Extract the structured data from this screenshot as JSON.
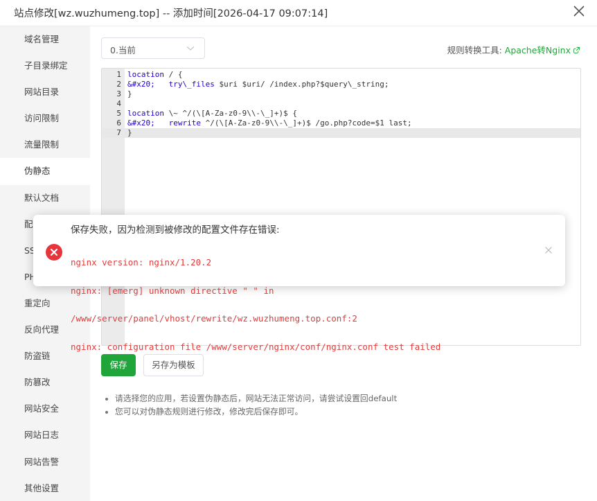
{
  "window": {
    "title": "站点修改[wz.wuzhumeng.top] -- 添加时间[2026-04-17 09:07:14]"
  },
  "sidebar": {
    "items": [
      {
        "label": "域名管理"
      },
      {
        "label": "子目录绑定"
      },
      {
        "label": "网站目录"
      },
      {
        "label": "访问限制"
      },
      {
        "label": "流量限制"
      },
      {
        "label": "伪静态",
        "active": true
      },
      {
        "label": "默认文档"
      },
      {
        "label": "配置文件"
      },
      {
        "label": "SSL"
      },
      {
        "label": "PHP"
      },
      {
        "label": "重定向"
      },
      {
        "label": "反向代理"
      },
      {
        "label": "防盗链"
      },
      {
        "label": "防篡改"
      },
      {
        "label": "网站安全"
      },
      {
        "label": "网站日志"
      },
      {
        "label": "网站告警"
      },
      {
        "label": "其他设置"
      }
    ]
  },
  "main": {
    "select_value": "0.当前",
    "tool_label": "规则转换工具:",
    "tool_link": "Apache转Nginx",
    "editor_lines": [
      {
        "num": "1",
        "code": "location / {"
      },
      {
        "num": "2",
        "code": "&#x20;   try\\_files $uri $uri/ /index.php?$query\\_string;"
      },
      {
        "num": "3",
        "code": "}"
      },
      {
        "num": "4",
        "code": ""
      },
      {
        "num": "5",
        "code": "location \\~ ^/(\\[A-Za-z0-9\\\\-\\_]+)$ {"
      },
      {
        "num": "6",
        "code": "&#x20;   rewrite ^/(\\[A-Za-z0-9\\\\-\\_]+)$ /go.php?code=$1 last;"
      },
      {
        "num": "7",
        "code": "}",
        "active": true
      }
    ],
    "save_label": "保存",
    "save_template_label": "另存为模板",
    "tips": [
      "请选择您的应用，若设置伪静态后，网站无法正常访问，请尝试设置回default",
      "您可以对伪静态规则进行修改，修改完后保存即可。"
    ]
  },
  "toast": {
    "title": "保存失败，因为检测到被修改的配置文件存在错误:",
    "lines": [
      "nginx version: nginx/1.20.2",
      "nginx: [emerg] unknown directive \" \" in",
      "/www/server/panel/vhost/rewrite/wz.wuzhumeng.top.conf:2",
      "nginx: configuration file /www/server/nginx/conf/nginx.conf test failed"
    ]
  },
  "colors": {
    "accent": "#20a53a",
    "error": "#e03c3c",
    "sidebar_bg": "#f4f4f4"
  },
  "icons": {
    "close": "close-icon",
    "chevron": "chevron-down-icon",
    "external_link": "external-link-icon",
    "error": "error-circle-icon",
    "toast_close": "close-icon"
  }
}
